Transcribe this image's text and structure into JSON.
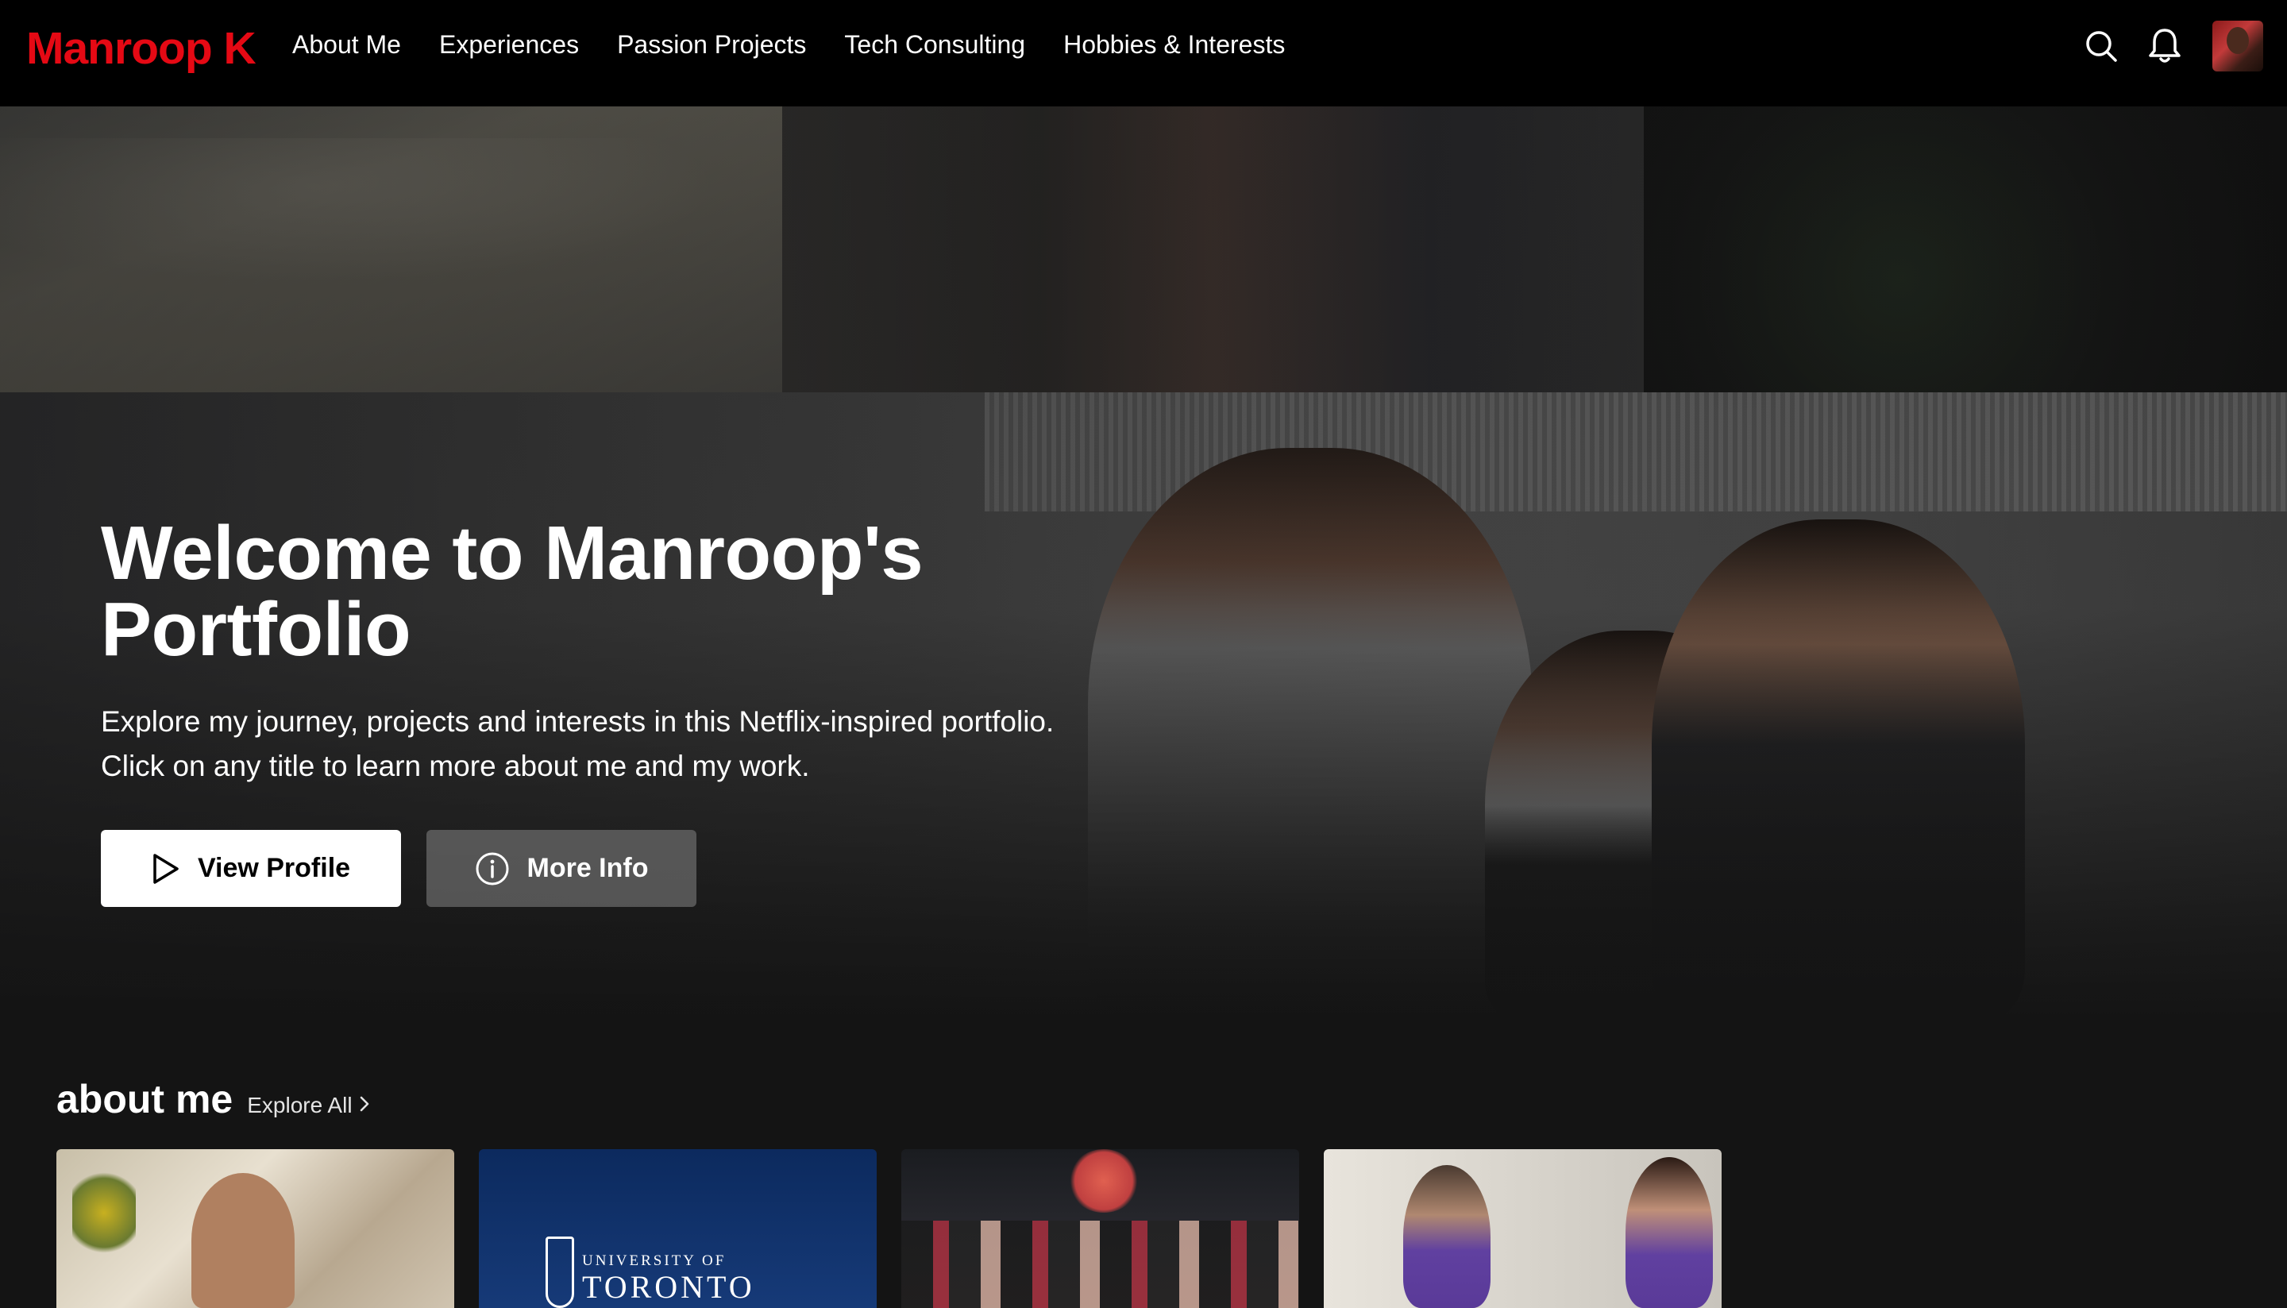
{
  "brand": {
    "logo_text": "Manroop K",
    "accent": "#e50914"
  },
  "nav": {
    "links": [
      "About Me",
      "Experiences",
      "Passion Projects",
      "Tech Consulting",
      "Hobbies & Interests"
    ],
    "icons": [
      "search-icon",
      "bell-icon"
    ]
  },
  "hero": {
    "title_line1": "Welcome to Manroop's",
    "title_line2": "Portfolio",
    "description_line1": "Explore my journey, projects and interests in this Netflix-inspired portfolio.",
    "description_line2": "Click on any title to learn more about me and my work.",
    "primary_button": "View Profile",
    "secondary_button": "More Info"
  },
  "row": {
    "title": "about me",
    "explore_label": "Explore All",
    "tiles": [
      {
        "name": "childhood-photo"
      },
      {
        "name": "university-of-toronto",
        "caption_small": "UNIVERSITY OF",
        "caption_large": "TORONTO"
      },
      {
        "name": "graduation-photo"
      },
      {
        "name": "friends-photo"
      }
    ]
  }
}
